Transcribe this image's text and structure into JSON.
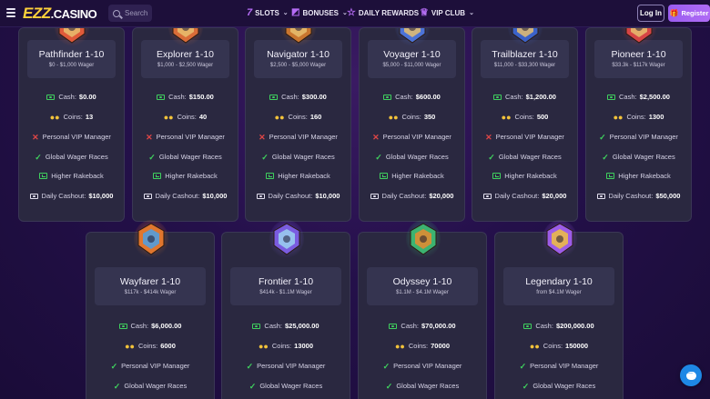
{
  "nav": {
    "logo_ezz": "EZZ",
    "logo_casino": ".CASINO",
    "search_placeholder": "Search",
    "items": [
      {
        "label": "SLOTS",
        "icon": "seven-icon"
      },
      {
        "label": "BONUSES",
        "icon": "percent-icon"
      },
      {
        "label": "DAILY REWARDS",
        "icon": "star-icon"
      },
      {
        "label": "VIP CLUB",
        "icon": "crown-icon"
      }
    ],
    "login_label": "Log In",
    "register_label": "Register"
  },
  "labels": {
    "cash": "Cash:",
    "coins": "Coins:",
    "vip_manager": "Personal VIP Manager",
    "wager_races": "Global Wager Races",
    "rakeback": "Higher Rakeback",
    "daily_cashout": "Daily Cashout:"
  },
  "colors": {
    "accent": "#9a5cf0",
    "logo": "#ffd23a",
    "check": "#3fd15e",
    "cross": "#e04646"
  },
  "tiers_top": [
    {
      "name": "Pathfinder 1-10",
      "wager": "$0 - $1,000 Wager",
      "cash": "$0.00",
      "coins": "13",
      "vip_manager": false,
      "daily_cashout": "$10,000",
      "badge_color": "#e05a3a"
    },
    {
      "name": "Explorer 1-10",
      "wager": "$1,000 - $2,500 Wager",
      "cash": "$150.00",
      "coins": "40",
      "vip_manager": false,
      "daily_cashout": "$10,000",
      "badge_color": "#d96c38"
    },
    {
      "name": "Navigator 1-10",
      "wager": "$2,500 - $5,000 Wager",
      "cash": "$300.00",
      "coins": "160",
      "vip_manager": false,
      "daily_cashout": "$10,000",
      "badge_color": "#c9762f"
    },
    {
      "name": "Voyager 1-10",
      "wager": "$5,000 - $11,000 Wager",
      "cash": "$600.00",
      "coins": "350",
      "vip_manager": false,
      "daily_cashout": "$20,000",
      "badge_color": "#4c73d8"
    },
    {
      "name": "Trailblazer 1-10",
      "wager": "$11,000 - $33,300 Wager",
      "cash": "$1,200.00",
      "coins": "500",
      "vip_manager": false,
      "daily_cashout": "$20,000",
      "badge_color": "#3b62c9"
    },
    {
      "name": "Pioneer 1-10",
      "wager": "$33.3k - $117k Wager",
      "cash": "$2,500.00",
      "coins": "1300",
      "vip_manager": true,
      "daily_cashout": "$50,000",
      "badge_color": "#d64545"
    }
  ],
  "tiers_bottom": [
    {
      "name": "Wayfarer 1-10",
      "wager": "$117k - $414k Wager",
      "cash": "$6,000.00",
      "coins": "6000",
      "badge_color": "#e0762e",
      "badge_inner": "#4aa0e6"
    },
    {
      "name": "Frontier 1-10",
      "wager": "$414k - $1.1M Wager",
      "cash": "$25,000.00",
      "coins": "13000",
      "badge_color": "#7a5ce0",
      "badge_inner": "#9bd1f0"
    },
    {
      "name": "Odyssey 1-10",
      "wager": "$1.1M - $4.1M Wager",
      "cash": "$70,000.00",
      "coins": "70000",
      "badge_color": "#3cb371",
      "badge_inner": "#e8892f"
    },
    {
      "name": "Legendary 1-10",
      "wager": "from $4.1M Wager",
      "cash": "$200,000.00",
      "coins": "150000",
      "badge_color": "#9c5ce8",
      "badge_inner": "#f0c040"
    }
  ]
}
